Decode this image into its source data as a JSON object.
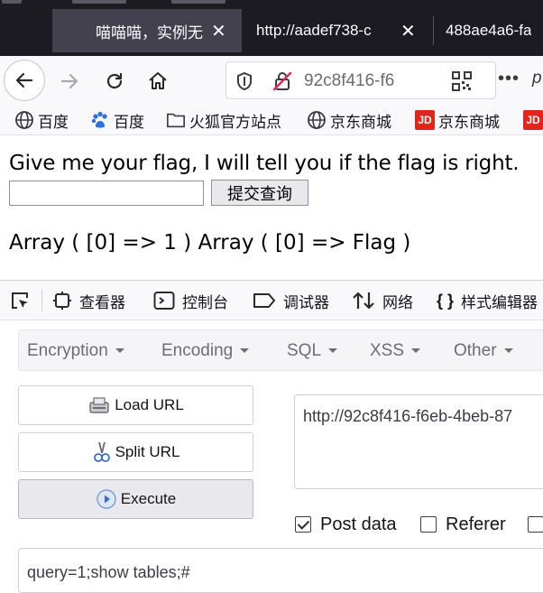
{
  "browser": {
    "tabs": [
      {
        "title": "喵喵喵，实例无",
        "close": "✕",
        "active": true
      },
      {
        "title": "http://aadef738-c",
        "close": "✕",
        "active": false
      },
      {
        "title": "488ae4a6-fa",
        "close": "",
        "active": false
      }
    ],
    "url": "92c8f416-f6",
    "more": "•••",
    "trailing": "p"
  },
  "bookmarks": [
    {
      "label": "百度",
      "icon": "globe-icon"
    },
    {
      "label": "百度",
      "icon": "baidu-paw-icon"
    },
    {
      "label": "火狐官方站点",
      "icon": "folder-icon"
    },
    {
      "label": "京东商城",
      "icon": "globe-icon"
    },
    {
      "label": "京东商城",
      "icon": "jd-logo-icon",
      "badge": "JD"
    },
    {
      "label": "",
      "icon": "jd-logo-icon",
      "badge": "JD"
    }
  ],
  "page": {
    "prompt": "Give me your flag, I will tell you if the flag is right.",
    "flag_input_value": "",
    "submit_label": "提交查询",
    "result": "Array ( [0] => 1 ) Array ( [0] => Flag )"
  },
  "devtools": {
    "tools": [
      {
        "label": "查看器",
        "icon": "inspector-icon"
      },
      {
        "label": "控制台",
        "icon": "console-icon"
      },
      {
        "label": "调试器",
        "icon": "debugger-icon"
      },
      {
        "label": "网络",
        "icon": "network-icon"
      },
      {
        "label": "样式编辑器",
        "icon": "style-editor-icon"
      }
    ]
  },
  "hackbar": {
    "menu": [
      "Encryption",
      "Encoding",
      "SQL",
      "XSS",
      "Other"
    ],
    "buttons": {
      "load": "Load URL",
      "split": "Split URL",
      "execute": "Execute"
    },
    "url_value": "http://92c8f416-f6eb-4beb-87",
    "options": [
      {
        "label": "Post data",
        "checked": true
      },
      {
        "label": "Referer",
        "checked": false
      },
      {
        "label": "",
        "checked": false
      }
    ],
    "post_value": "query=1;show tables;#"
  }
}
